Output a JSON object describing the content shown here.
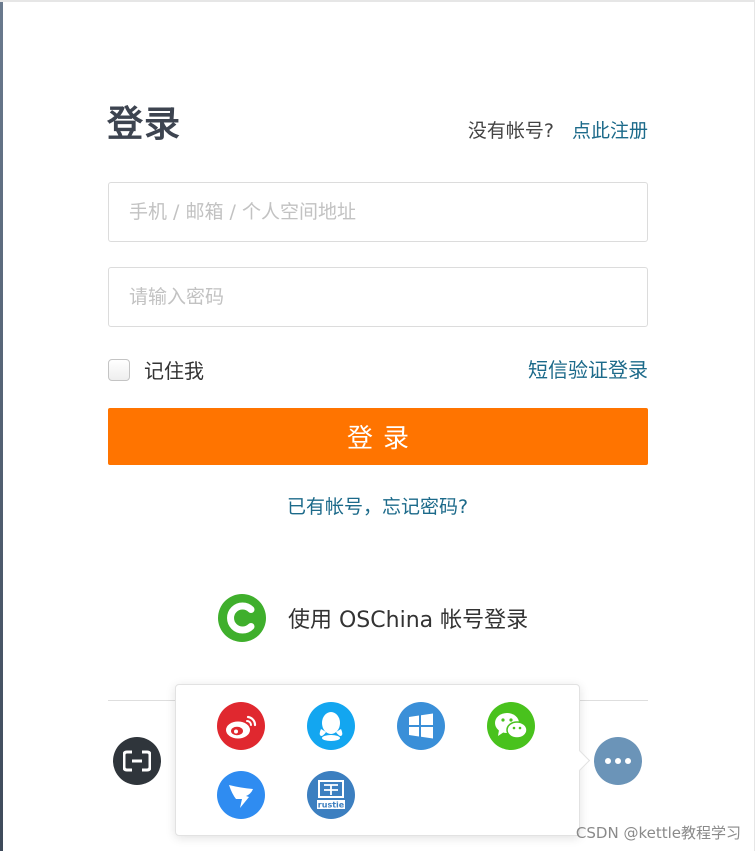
{
  "header": {
    "title": "登录",
    "no_account_text": "没有帐号?",
    "signup_link": "点此注册"
  },
  "form": {
    "account_placeholder": "手机 / 邮箱 / 个人空间地址",
    "account_value": "",
    "password_placeholder": "请输入密码",
    "password_value": "",
    "remember_label": "记住我",
    "remember_checked": false,
    "sms_login_link": "短信验证登录",
    "login_button": "登录"
  },
  "forgot_link": "已有帐号，忘记密码?",
  "oschina_login": {
    "label": "使用 OSChina 帐号登录",
    "icon": "oschina-logo-icon"
  },
  "social_popover": {
    "items": [
      {
        "icon": "weibo-icon"
      },
      {
        "icon": "qq-icon"
      },
      {
        "icon": "windows-icon"
      },
      {
        "icon": "wechat-icon"
      },
      {
        "icon": "dingtalk-icon"
      },
      {
        "icon": "rustie-icon",
        "text": "rustie"
      }
    ]
  },
  "side_icons": [
    {
      "icon": "aliyun-icon"
    },
    {
      "icon": "more-icon"
    }
  ],
  "watermark": "CSDN @kettle教程学习",
  "colors": {
    "primary": "#ff7400",
    "link": "#1c6a8a",
    "oschina": "#3faf2c"
  }
}
